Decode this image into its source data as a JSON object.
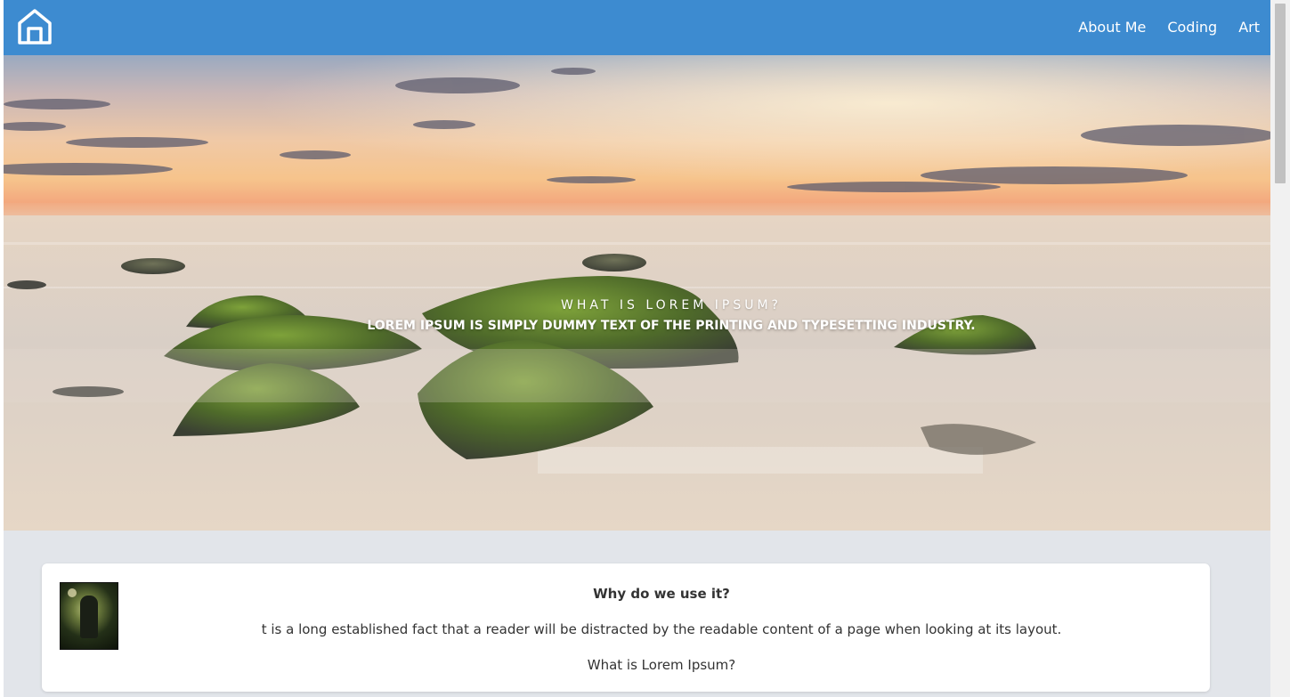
{
  "header": {
    "home_icon": "home-icon",
    "nav": [
      {
        "label": "About Me"
      },
      {
        "label": "Coding"
      },
      {
        "label": "Art"
      }
    ],
    "color": "#3d8bd0"
  },
  "hero": {
    "kicker": "What is Lorem Ipsum?",
    "headline": "Lorem Ipsum is simply dummy text of the printing and typesetting industry."
  },
  "card": {
    "title": "Why do we use it?",
    "text": "t is a long established fact that a reader will be distracted by the readable content of a page when looking at its layout.",
    "text2": "What is Lorem Ipsum?"
  }
}
